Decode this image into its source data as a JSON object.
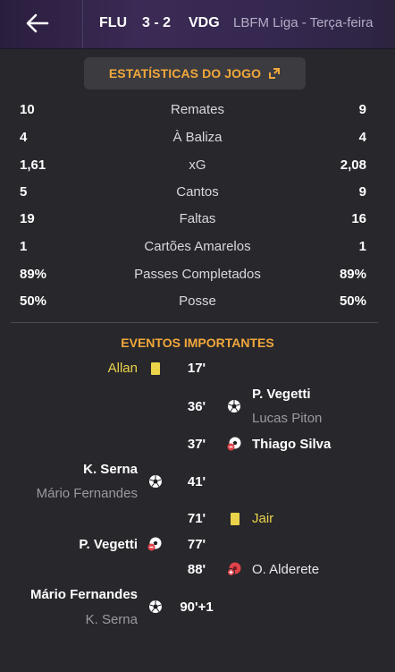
{
  "header": {
    "home_team": "FLU",
    "score": "3 - 2",
    "away_team": "VDG",
    "league": "LBFM Liga   -   Terça-feira"
  },
  "stats": {
    "title": "ESTATÍSTICAS DO JOGO",
    "rows": [
      {
        "home": "10",
        "name": "Remates",
        "away": "9"
      },
      {
        "home": "4",
        "name": "À Baliza",
        "away": "4"
      },
      {
        "home": "1,61",
        "name": "xG",
        "away": "2,08"
      },
      {
        "home": "5",
        "name": "Cantos",
        "away": "9"
      },
      {
        "home": "19",
        "name": "Faltas",
        "away": "16"
      },
      {
        "home": "1",
        "name": "Cartões Amarelos",
        "away": "1"
      },
      {
        "home": "89%",
        "name": "Passes Completados",
        "away": "89%"
      },
      {
        "home": "50%",
        "name": "Posse",
        "away": "50%"
      }
    ]
  },
  "events": {
    "title": "EVENTOS IMPORTANTES",
    "items": [
      {
        "minute": "17'",
        "side": "home",
        "type": "yellow-card",
        "player": "Allan",
        "assist": ""
      },
      {
        "minute": "36'",
        "side": "away",
        "type": "goal",
        "player": "P. Vegetti",
        "assist": "Lucas Piton"
      },
      {
        "minute": "37'",
        "side": "away",
        "type": "substitution",
        "player": "Thiago Silva",
        "assist": ""
      },
      {
        "minute": "41'",
        "side": "home",
        "type": "goal",
        "player": "K. Serna",
        "assist": "Mário Fernandes"
      },
      {
        "minute": "71'",
        "side": "away",
        "type": "yellow-card",
        "player": "Jair",
        "assist": ""
      },
      {
        "minute": "77'",
        "side": "home",
        "type": "substitution",
        "player": "P. Vegetti",
        "assist": ""
      },
      {
        "minute": "88'",
        "side": "away",
        "type": "injury",
        "player": "O. Alderete",
        "assist": ""
      },
      {
        "minute": "90'+1",
        "side": "home",
        "type": "goal",
        "player": "Mário Fernandes",
        "assist": "K. Serna"
      }
    ]
  },
  "colors": {
    "accent": "#f2a83b",
    "yellow_card": "#ecd44a",
    "background": "#27272c",
    "header": "#3b2a55",
    "red": "#e0434a"
  },
  "icons": {
    "back": "arrow-left-icon",
    "expand": "expand-icon",
    "yellow_card": "yellow-card-icon",
    "goal": "football-icon",
    "substitution": "substitution-icon",
    "injury": "injury-icon"
  }
}
